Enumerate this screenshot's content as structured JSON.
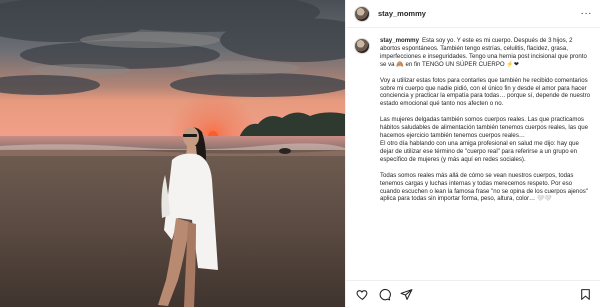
{
  "post": {
    "username": "stay_mommy",
    "more_label": "···"
  },
  "caption": {
    "paragraphs": [
      "Esta soy yo. Y este es mi cuerpo. Después de 3 hijos, 2 abortos espontáneos. También tengo estrías, celulitis, flacidez, grasa, imperfecciones e inseguridades. Tengo una hernia post incisional que pronto se va 🙈 en fin TENGO UN SÚPER CUERPO ⚡❤",
      "Voy a utilizar estas fotos para contarles que también he recibido comentarios sobre mi cuerpo que nadie pidió, con el único fin y desde el amor para hacer conciencia y practicar la empatía para todas… porque sí, depende de nuestro estado emocional qué tanto nos afecten o no.",
      "Las mujeres delgadas también somos cuerpos reales. Las que practicamos hábitos saludables de alimentación también tenemos cuerpos reales, las que hacemos ejercicio también tenemos cuerpos reales…",
      "El otro día hablando con una amiga profesional en salud me dijo: hay que dejar de utilizar ese término de \"cuerpo real\" para referirse a un grupo en específico de mujeres (y más aquí en redes sociales).",
      "Todas somos reales más allá de cómo se vean nuestros cuerpos, todas tenemos cargas y luchas internas y todas merecemos respeto. Por eso cuando escuchen o lean la famosa frase \"no se opina de los cuerpos ajenos\" aplica para todas sin importar forma, peso, altura, color… 🤍🤍"
    ]
  },
  "icons": {
    "more": "more-horizontal-icon",
    "like": "heart-icon",
    "comment": "comment-icon",
    "share": "send-icon",
    "save": "bookmark-icon"
  },
  "colors": {
    "text": "#262626",
    "divider": "#efefef",
    "sunset": "#e8593a"
  }
}
